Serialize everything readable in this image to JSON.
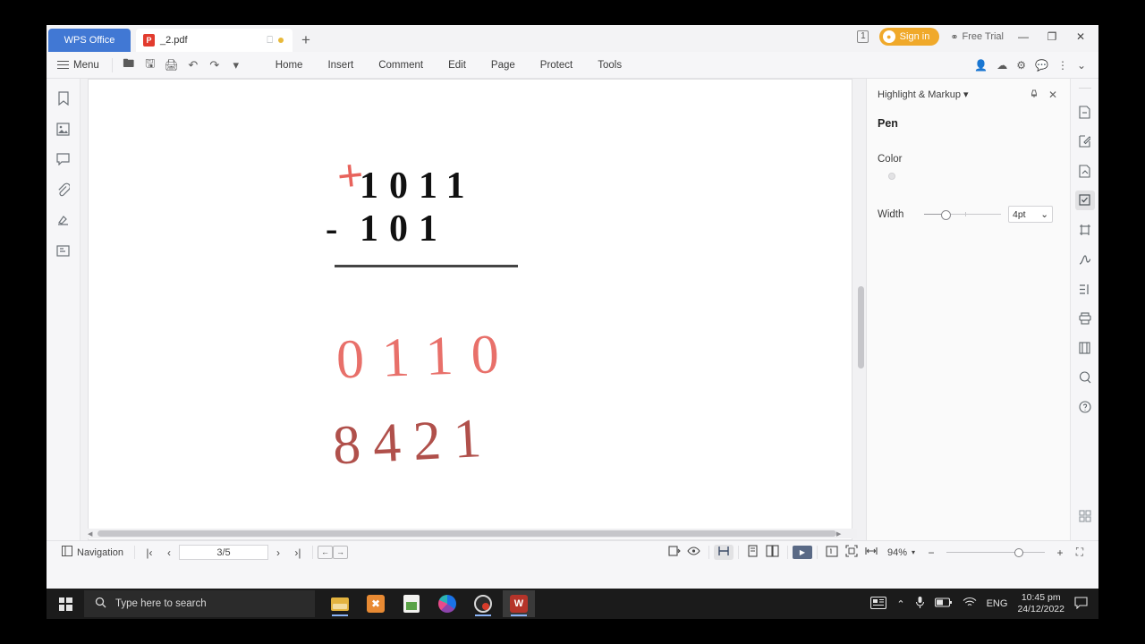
{
  "titlebar": {
    "app_tab": "WPS Office",
    "doc_tab": "_2.pdf",
    "pdf_badge": "P",
    "new_tab": "+",
    "window_count": "1",
    "sign_in": "Sign in",
    "free_trial": "Free Trial",
    "minimize": "—",
    "maximize": "❐",
    "close": "✕"
  },
  "toolbar": {
    "menu_label": "Menu",
    "quick_icons": [
      "open-icon",
      "save-icon",
      "print-icon",
      "undo-icon",
      "redo-icon",
      "customize-icon"
    ],
    "tabs": [
      {
        "label": "Home"
      },
      {
        "label": "Insert"
      },
      {
        "label": "Comment"
      },
      {
        "label": "Edit"
      },
      {
        "label": "Page"
      },
      {
        "label": "Protect"
      },
      {
        "label": "Tools"
      }
    ],
    "right_icons": [
      "share-user-icon",
      "upload-cloud-icon",
      "settings-icon",
      "feedback-icon",
      "more-icon",
      "collapse-ribbon-icon"
    ]
  },
  "left_rail": {
    "items": [
      {
        "name": "bookmark-icon",
        "glyph": "☆"
      },
      {
        "name": "thumbnail-icon",
        "glyph": "❑"
      },
      {
        "name": "comment-icon",
        "glyph": "▭"
      },
      {
        "name": "attachment-icon",
        "glyph": "⎘"
      },
      {
        "name": "stamp-icon",
        "glyph": "◢"
      },
      {
        "name": "form-icon",
        "glyph": "⎙"
      }
    ]
  },
  "document": {
    "problem": {
      "minuend": "1011",
      "operator": "-",
      "subtrahend": "101"
    },
    "annotations": {
      "carry_mark": "+",
      "answer_ink": "0110",
      "place_values_ink": "8421"
    },
    "cursor": "pen-cursor"
  },
  "panel": {
    "header_title": "Highlight & Markup",
    "header_caret": "▾",
    "pin_icon": "pin-icon",
    "close_icon": "✕",
    "section_title": "Pen",
    "color_label": "Color",
    "colors": [
      {
        "name": "red",
        "hex": "#f42020"
      },
      {
        "name": "dark-red",
        "hex": "#8e1a12"
      },
      {
        "name": "black",
        "hex": "#111111"
      },
      {
        "name": "green",
        "hex": "#128b1e"
      },
      {
        "name": "blue",
        "hex": "#2088e8"
      },
      {
        "name": "purple",
        "hex": "#5a0fa8"
      },
      {
        "name": "more-colors",
        "hex": "rainbow"
      }
    ],
    "selected_color_index": 1,
    "width_label": "Width",
    "width_value": "4pt",
    "width_caret": "⌄"
  },
  "far_right_rail": {
    "items": [
      {
        "name": "page-extract-icon",
        "glyph": "Ὄ4"
      },
      {
        "name": "edit-text-icon",
        "glyph": "✎"
      },
      {
        "name": "page-convert-icon",
        "glyph": "↪"
      },
      {
        "name": "markup-icon",
        "glyph": "☑",
        "active": true
      },
      {
        "name": "crop-icon",
        "glyph": "⧉"
      },
      {
        "name": "signature-icon",
        "glyph": "✒"
      },
      {
        "name": "compare-icon",
        "glyph": "≣"
      },
      {
        "name": "print-icon",
        "glyph": "⎙"
      },
      {
        "name": "split-icon",
        "glyph": "▤"
      },
      {
        "name": "ocr-icon",
        "glyph": "Ⓐ"
      },
      {
        "name": "help-icon",
        "glyph": "?"
      }
    ],
    "apps_grid_icon": "apps-grid-icon"
  },
  "statusbar": {
    "navigation_label": "Navigation",
    "first_page": "|‹",
    "prev_page": "‹",
    "page_value": "3/5",
    "next_page": "›",
    "last_page": "›|",
    "back": "←",
    "forward": "→",
    "tools": [
      "fit-icon",
      "eye-icon",
      "single-page-icon",
      "facing-page-icon",
      "presentation-icon",
      "actual-size-icon",
      "fit-page-icon",
      "fit-width-icon"
    ],
    "zoom_value": "94%",
    "zoom_out": "−",
    "zoom_in": "+",
    "fullscreen": "⛶"
  },
  "taskbar": {
    "search_placeholder": "Type here to search",
    "apps": [
      {
        "name": "file-explorer"
      },
      {
        "name": "xmind-app"
      },
      {
        "name": "notes-app"
      },
      {
        "name": "chrome-browser"
      },
      {
        "name": "obs-studio"
      },
      {
        "name": "wps-office",
        "active": true
      }
    ],
    "tray": {
      "news_icon": "news-icon",
      "chevron_icon": "⌃",
      "mic_icon": "Ἲ4",
      "battery_icon": "battery-icon",
      "wifi_icon": "wifi-icon",
      "language": "ENG",
      "time": "10:45 pm",
      "date": "24/12/2022",
      "action_center": "notification-icon"
    }
  }
}
